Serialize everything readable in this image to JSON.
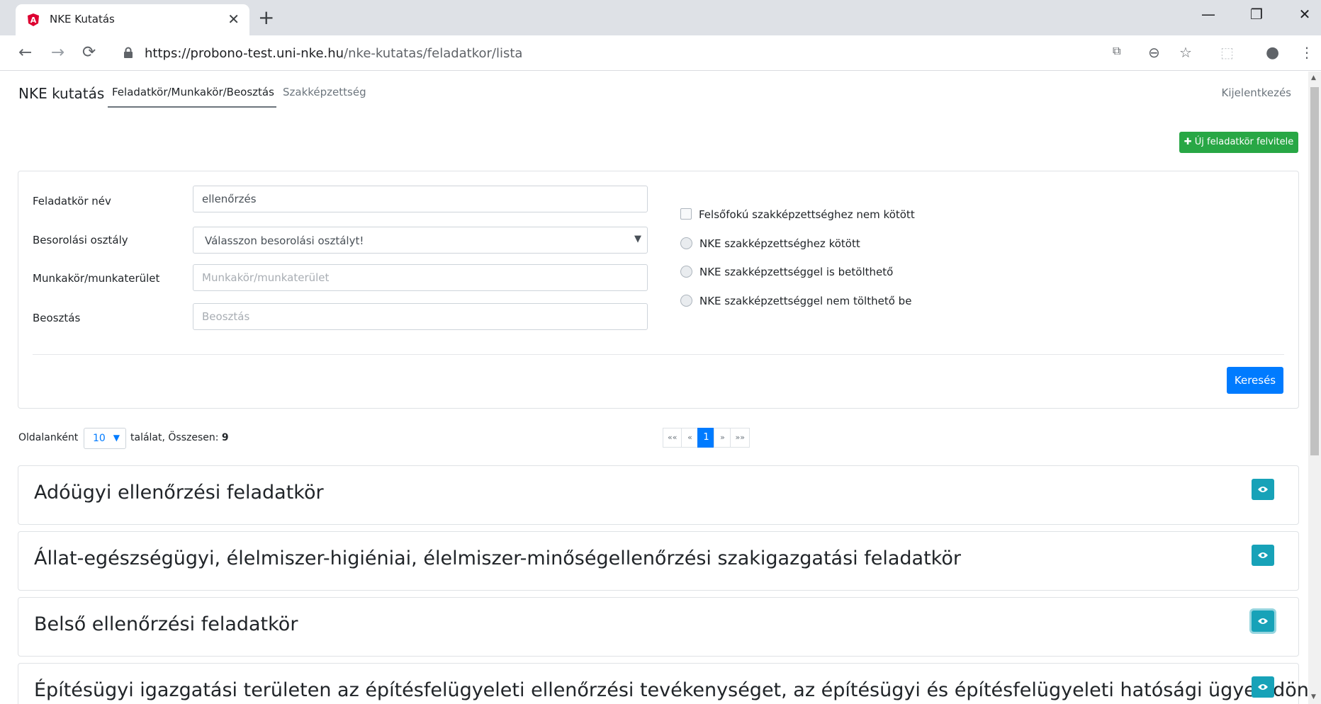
{
  "browser": {
    "tab_title": "NKE Kutatás",
    "url_host": "https://probono-test.uni-nke.hu",
    "url_path": "/nke-kutatas/feladatkor/lista"
  },
  "nav": {
    "brand": "NKE kutatás",
    "links": [
      "Feladatkör/Munkakör/Beosztás",
      "Szakképzettség"
    ],
    "logout": "Kijelentkezés"
  },
  "actions": {
    "new_button": "✚ Új feladatkör felvitele"
  },
  "search": {
    "name_label": "Feladatkör név",
    "name_value": "ellenőrzés",
    "class_label": "Besorolási osztály",
    "class_value": "Válasszon besorolási osztályt!",
    "job_label": "Munkakör/munkaterület",
    "job_placeholder": "Munkakör/munkaterület",
    "position_label": "Beosztás",
    "position_placeholder": "Beosztás",
    "options": [
      "Felsőfokú szakképzettséghez nem kötött",
      "NKE szakképzettséghez kötött",
      "NKE szakképzettséggel is betölthető",
      "NKE szakképzettséggel nem tölthető be"
    ],
    "search_button": "Keresés"
  },
  "paging": {
    "per_page_label": "Oldalanként",
    "per_page_value": "10",
    "results_label": "találat, Összesen:",
    "total": "9",
    "first": "««",
    "prev": "«",
    "current": "1",
    "next": "»",
    "last": "»»"
  },
  "results": [
    "Adóügyi ellenőrzési feladatkör",
    "Állat-egészségügyi, élelmiszer-higiéniai, élelmiszer-minőségellenőrzési szakigazgatási feladatkör",
    "Belső ellenőrzési feladatkör",
    "Építésügyi igazgatási területen az építésfelügyeleti ellenőrzési tevékenységet, az építésügyi és építésfelügyeleti hatósági ügyek döntése"
  ],
  "colors": {
    "green": "#28a745",
    "blue": "#007bff",
    "teal": "#17a2b8"
  }
}
